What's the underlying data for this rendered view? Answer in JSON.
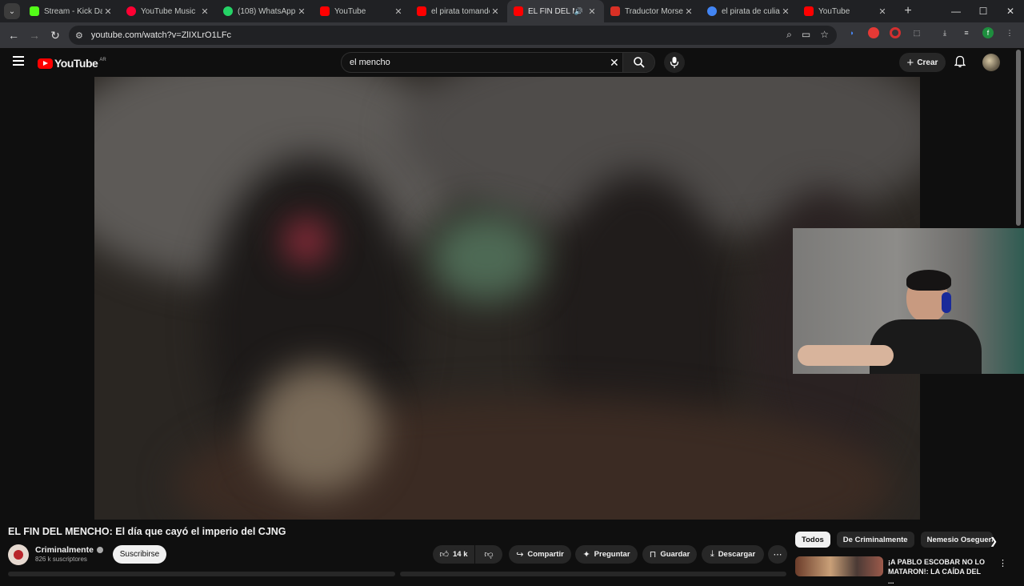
{
  "browser": {
    "tabs": [
      {
        "title": "Stream - Kick Dash",
        "color": "#53fc18"
      },
      {
        "title": "YouTube Music",
        "color": "#ff0033"
      },
      {
        "title": "(108) WhatsApp",
        "color": "#25d366"
      },
      {
        "title": "YouTube",
        "color": "#ff0000"
      },
      {
        "title": "el pirata tomando",
        "color": "#ff0000"
      },
      {
        "title": "EL FIN DEL ME",
        "color": "#ff0000"
      },
      {
        "title": "Traductor Morse",
        "color": "#d93025"
      },
      {
        "title": "el pirata de culiac",
        "color": "#4285f4"
      },
      {
        "title": "YouTube",
        "color": "#ff0000"
      }
    ],
    "url": "youtube.com/watch?v=ZlIXLrO1LFc"
  },
  "youtube": {
    "logo_text": "YouTube",
    "country_code": "AR",
    "search_value": "el mencho",
    "create_label": "Crear"
  },
  "video": {
    "title": "EL FIN DEL MENCHO: El día que cayó el imperio del CJNG",
    "channel_name": "Criminalmente",
    "subscribers": "826 k suscriptores",
    "subscribe_label": "Suscribirse",
    "likes": "14 k",
    "share_label": "Compartir",
    "ask_label": "Preguntar",
    "save_label": "Guardar",
    "download_label": "Descargar"
  },
  "sidebar": {
    "chips": [
      "Todos",
      "De Criminalmente",
      "Nemesio Oseguera"
    ],
    "recommendation_title": "¡A PABLO ESCOBAR NO LO MATARON!: LA CAÍDA DEL ..."
  },
  "colors": {
    "accent": "#ff0000",
    "background": "#0f0f0f",
    "surface": "#272727"
  }
}
